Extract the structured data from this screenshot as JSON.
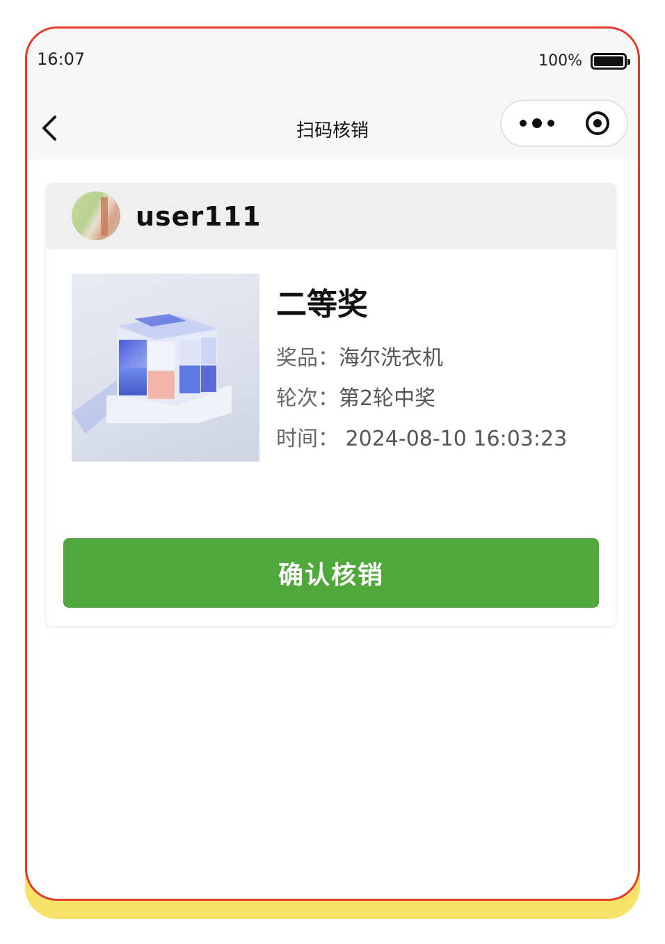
{
  "status_bar": {
    "time": "16:07",
    "battery_percent": "100%"
  },
  "nav": {
    "title": "扫码核销",
    "back_icon": "chevron-left-icon",
    "more_icon": "more-dots-icon",
    "close_icon": "target-circle-icon"
  },
  "record": {
    "username": "user111",
    "prize_level": "二等奖",
    "prize_label": "奖品：",
    "prize_value": "海尔洗衣机",
    "round_label": "轮次：",
    "round_value": "第2轮中奖",
    "time_label": "时间：",
    "time_value": " 2024-08-10 16:03:23"
  },
  "actions": {
    "confirm_label": "确认核销"
  },
  "colors": {
    "accent_green": "#51a83a",
    "frame_red": "#e4392b",
    "frame_yellow": "#f6e26a",
    "header_gray": "#efefef"
  }
}
